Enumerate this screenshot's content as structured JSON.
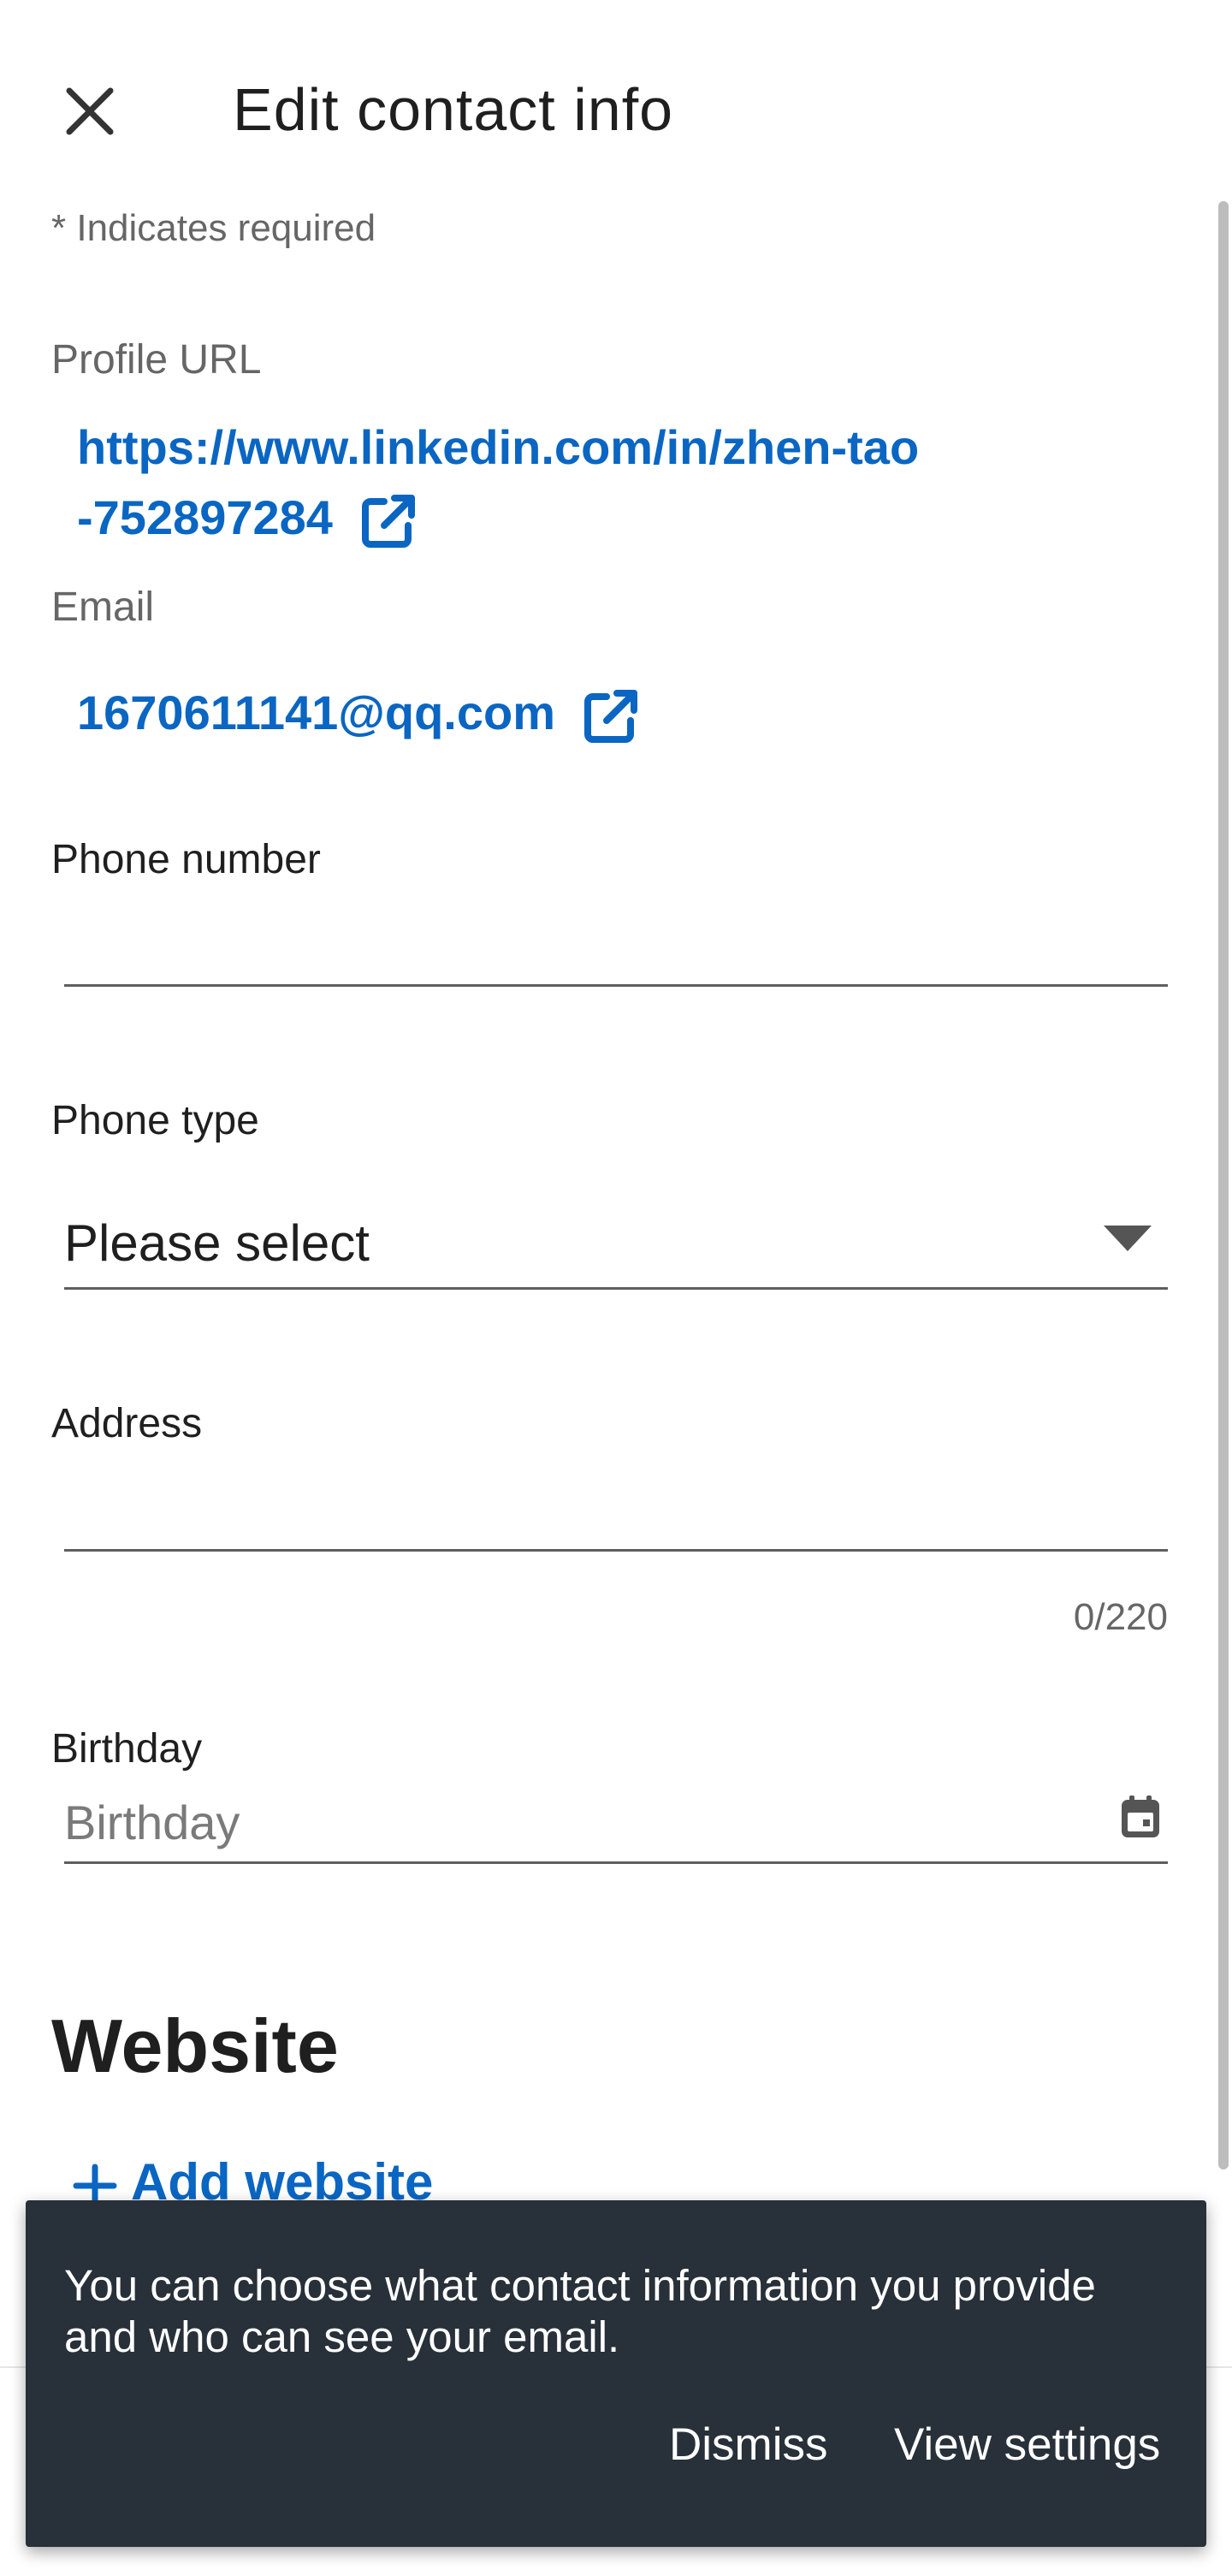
{
  "header": {
    "title": "Edit contact info",
    "close_icon": "close-icon"
  },
  "form": {
    "required_note": "* Indicates required",
    "profile_url": {
      "label": "Profile URL",
      "line1": "https://www.linkedin.com/in/zhen-tao",
      "line2": "-752897284",
      "icon": "external-link-icon"
    },
    "email": {
      "label": "Email",
      "value": "1670611141@qq.com",
      "icon": "external-link-icon"
    },
    "phone_number": {
      "label": "Phone number",
      "value": ""
    },
    "phone_type": {
      "label": "Phone type",
      "selected": "Please select",
      "icon": "caret-down-icon"
    },
    "address": {
      "label": "Address",
      "value": "",
      "counter": "0/220"
    },
    "birthday": {
      "label": "Birthday",
      "placeholder": "Birthday",
      "icon": "calendar-icon"
    }
  },
  "website": {
    "title": "Website",
    "add_label": "Add website",
    "icon": "plus-icon"
  },
  "snackbar": {
    "message": "You can choose what contact information you provide and who can see your email.",
    "dismiss_label": "Dismiss",
    "settings_label": "View settings"
  },
  "colors": {
    "accent": "#0a66c2",
    "snackbar_bg": "#283039",
    "text": "#1f1f1f",
    "muted": "#666666"
  }
}
